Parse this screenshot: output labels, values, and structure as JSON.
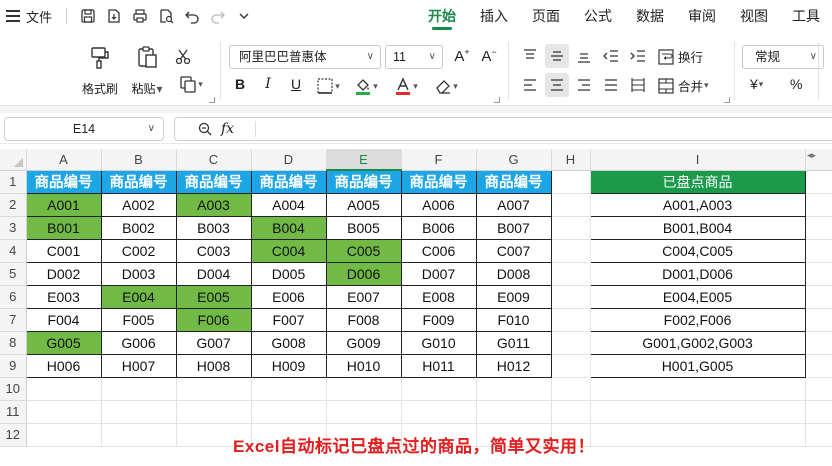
{
  "menu": {
    "file_label": "文件",
    "tabs": [
      {
        "label": "开始",
        "active": true
      },
      {
        "label": "插入",
        "active": false
      },
      {
        "label": "页面",
        "active": false
      },
      {
        "label": "公式",
        "active": false
      },
      {
        "label": "数据",
        "active": false
      },
      {
        "label": "审阅",
        "active": false
      },
      {
        "label": "视图",
        "active": false
      },
      {
        "label": "工具",
        "active": false
      }
    ]
  },
  "ribbon": {
    "format_painter": "格式刷",
    "paste": "粘贴",
    "font_name": "阿里巴巴普惠体",
    "font_size": "11",
    "wrap_text": "换行",
    "merge": "合并",
    "number_format": "常规",
    "currency_symbol": "¥",
    "percent_symbol": "%",
    "bold": "B",
    "italic": "I",
    "underline": "U"
  },
  "formula_bar": {
    "name_box": "E14",
    "fx_label": "fx",
    "content": ""
  },
  "sheet": {
    "columns": [
      "A",
      "B",
      "C",
      "D",
      "E",
      "F",
      "G",
      "H",
      "I"
    ],
    "selected_column": "E",
    "rows": [
      "1",
      "2",
      "3",
      "4",
      "5",
      "6",
      "7",
      "8",
      "9",
      "10",
      "11",
      "12"
    ],
    "header_row": [
      "商品编号",
      "商品编号",
      "商品编号",
      "商品编号",
      "商品编号",
      "商品编号",
      "商品编号"
    ],
    "data": [
      [
        "A001",
        "A002",
        "A003",
        "A004",
        "A005",
        "A006",
        "A007"
      ],
      [
        "B001",
        "B002",
        "B003",
        "B004",
        "B005",
        "B006",
        "B007"
      ],
      [
        "C001",
        "C002",
        "C003",
        "C004",
        "C005",
        "C006",
        "C007"
      ],
      [
        "D002",
        "D003",
        "D004",
        "D005",
        "D006",
        "D007",
        "D008"
      ],
      [
        "E003",
        "E004",
        "E005",
        "E006",
        "E007",
        "E008",
        "E009"
      ],
      [
        "F004",
        "F005",
        "F006",
        "F007",
        "F008",
        "F009",
        "F010"
      ],
      [
        "G005",
        "G006",
        "G007",
        "G008",
        "G009",
        "G010",
        "G011"
      ],
      [
        "H006",
        "H007",
        "H008",
        "H009",
        "H010",
        "H011",
        "H012"
      ]
    ],
    "highlighted": [
      [
        true,
        false,
        true,
        false,
        false,
        false,
        false
      ],
      [
        true,
        false,
        false,
        true,
        false,
        false,
        false
      ],
      [
        false,
        false,
        false,
        true,
        true,
        false,
        false
      ],
      [
        false,
        false,
        false,
        false,
        true,
        false,
        false
      ],
      [
        false,
        true,
        true,
        false,
        false,
        false,
        false
      ],
      [
        false,
        false,
        true,
        false,
        false,
        false,
        false
      ],
      [
        true,
        false,
        false,
        false,
        false,
        false,
        false
      ],
      [
        false,
        false,
        false,
        false,
        false,
        false,
        false
      ]
    ],
    "summary_header": "已盘点商品",
    "summary_values": [
      "A001,A003",
      "B001,B004",
      "C004,C005",
      "D001,D006",
      "E004,E005",
      "F002,F006",
      "G001,G002,G003",
      "H001,G005"
    ],
    "caption": "Excel自动标记已盘点过的商品，简单又实用！"
  },
  "colors": {
    "accent": "#1a8a4a",
    "header_blue": "#1da6e6",
    "summary_green": "#1a9a4a",
    "highlight_green": "#70ba45",
    "caption_red": "#e21d1d"
  }
}
